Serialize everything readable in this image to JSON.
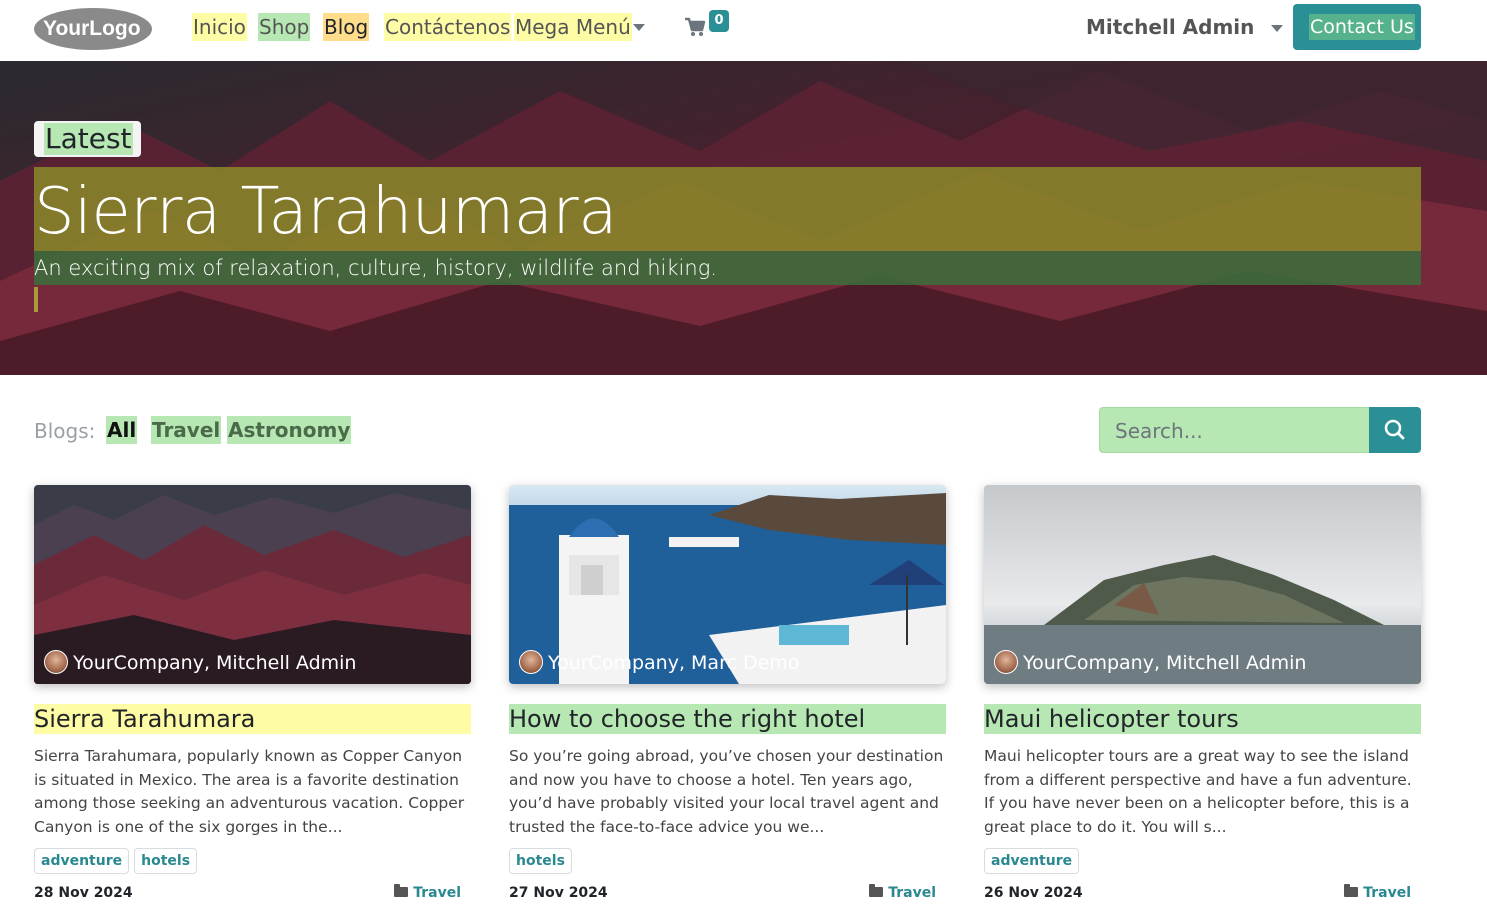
{
  "header": {
    "logo_text": "YourLogo",
    "nav": [
      "Inicio",
      "Shop",
      "Blog",
      "Contáctenos",
      "Mega Menú"
    ],
    "cart_count": "0",
    "user": "Mitchell Admin",
    "contact_button": "Contact Us"
  },
  "hero": {
    "badge": "Latest",
    "title": "Sierra Tarahumara",
    "subtitle": "An exciting mix of relaxation, culture, history, wildlife and hiking."
  },
  "filters": {
    "label": "Blogs:",
    "items": [
      "All",
      "Travel",
      "Astronomy"
    ],
    "search_placeholder": "Search..."
  },
  "posts": [
    {
      "author": "YourCompany, Mitchell Admin",
      "title": "Sierra Tarahumara",
      "excerpt": "Sierra Tarahumara, popularly known as Copper Canyon is situated in Mexico. The area is a favorite destination among those seeking an adventurous vacation. Copper Canyon is one of the six gorges in the...",
      "tags": [
        "adventure",
        "hotels"
      ],
      "date": "28 Nov 2024",
      "category": "Travel"
    },
    {
      "author": "YourCompany, Marc Demo",
      "title": "How to choose the right hotel",
      "excerpt": "So you’re going abroad, you’ve chosen your destination and now you have to choose a hotel. Ten years ago, you’d have probably visited your local travel agent and trusted the face-to-face advice you we...",
      "tags": [
        "hotels"
      ],
      "date": "27 Nov 2024",
      "category": "Travel"
    },
    {
      "author": "YourCompany, Mitchell Admin",
      "title": "Maui helicopter tours",
      "excerpt": "Maui helicopter tours are a great way to see the island from a different perspective and have a fun adventure. If you have never been on a helicopter before, this is a great place to do it. You will s...",
      "tags": [
        "adventure"
      ],
      "date": "26 Nov 2024",
      "category": "Travel"
    }
  ],
  "colors": {
    "primary": "#2a9095",
    "highlight_yellow": "#fffca6",
    "highlight_green": "#b7e8b3"
  }
}
